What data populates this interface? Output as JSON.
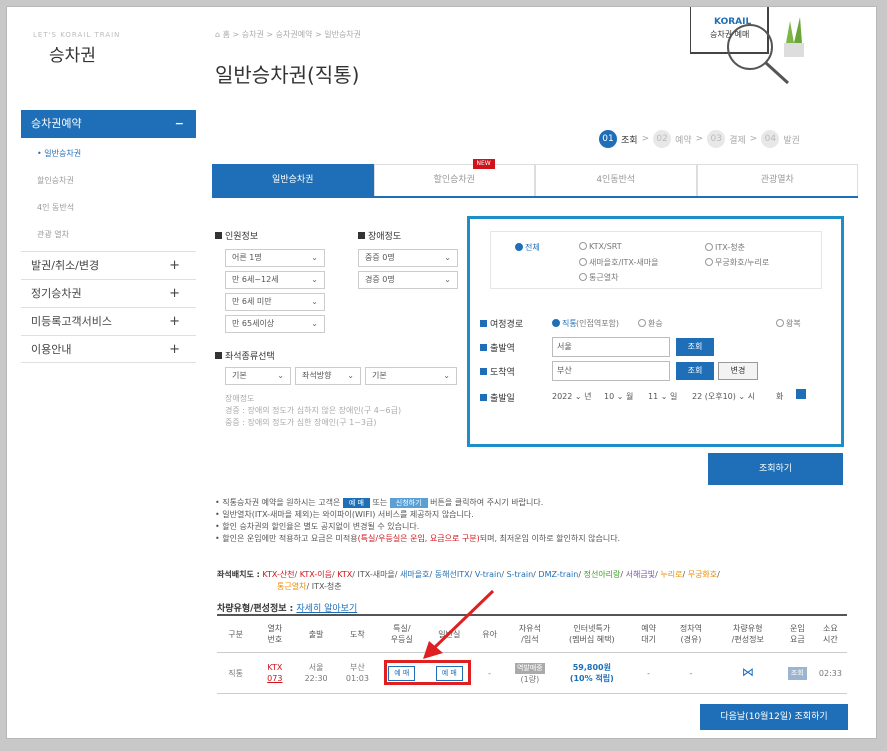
{
  "sidebar": {
    "slogan": "LET'S KORAIL TRAIN",
    "title": "승차권",
    "active_menu": "승차권예약",
    "active_toggle": "−",
    "subitems": [
      "• 일반승차권",
      "할인승차권",
      "4인 동반석",
      "관광 열차"
    ],
    "menus": [
      "발권/취소/변경",
      "정기승차권",
      "미등록고객서비스",
      "이용안내"
    ],
    "menu_toggle": "+"
  },
  "header": {
    "breadcrumb": "⌂ 홈 > 승차권 > 승차권예약 > 일반승차권",
    "title": "일반승차권(직통)",
    "logo_text": "KORAIL",
    "logo_sub": "승차권 예매"
  },
  "steps": [
    {
      "num": "01",
      "label": "조회",
      "active": true
    },
    {
      "num": "02",
      "label": "예약",
      "active": false
    },
    {
      "num": "03",
      "label": "결제",
      "active": false
    },
    {
      "num": "04",
      "label": "발권",
      "active": false
    }
  ],
  "step_sep": ">",
  "tabs": [
    "일반승차권",
    "할인승차권",
    "4인동반석",
    "관광열차"
  ],
  "new_badge": "NEW",
  "passengers": {
    "label": "인원정보",
    "adult": "어른 1명",
    "child": "만 6세~12세",
    "infant": "만 6세 미만",
    "senior": "만 65세이상",
    "disability_label": "장애정도",
    "severe": "중증 0명",
    "mild": "경증 0명",
    "arrow": "⌄"
  },
  "seat_select": {
    "label": "좌석종류선택",
    "basic": "기본",
    "direction": "좌석방향",
    "basic2": "기본",
    "note_title": "장애정도",
    "note1": "경증 : 장애의 정도가 심하지 않은 장애인(구 4~6급)",
    "note2": "중증 : 장애의 정도가 심한 장애인(구 1~3급)"
  },
  "train_types": [
    {
      "label": "전체",
      "checked": true
    },
    {
      "label": "KTX/SRT",
      "checked": false
    },
    {
      "label": "ITX-청춘",
      "checked": false
    },
    {
      "label": "새마을호/ITX-새마을",
      "checked": false
    },
    {
      "label": "무궁화호/누리로",
      "checked": false
    },
    {
      "label": "통근열차",
      "checked": false
    }
  ],
  "route": {
    "label": "여정경로",
    "direct": "직통",
    "direct_sub": "(인접역포함)",
    "transfer": "환승",
    "round": "왕복"
  },
  "origin": {
    "label": "출발역",
    "value": "서울",
    "btn": "조회"
  },
  "dest": {
    "label": "도착역",
    "value": "부산",
    "btn": "조회",
    "swap": "변경"
  },
  "date": {
    "label": "출발일",
    "year": "2022 ⌄ 년",
    "month": "10 ⌄ 월",
    "day": "11 ⌄ 일",
    "time": "22 (오후10) ⌄ 시",
    "weekday": "화"
  },
  "search_btn": "조회하기",
  "notices": {
    "n1_a": "• 직통승차권 예약을 원하시는 고객은",
    "n1_tag1": "예 매",
    "n1_mid": "또는",
    "n1_tag2": "신청하기",
    "n1_b": "버튼을 클릭하여 주시기 바랍니다.",
    "n2": "• 일반열차(ITX-새마을 제외)는 와이파이(WIFI) 서비스를 제공하지 않습니다.",
    "n3": "• 할인 승차권의 할인율은 별도 공지없이 변경될 수 있습니다.",
    "n4_a": "• 할인은 운임에만 적용하고 요금은 미적용",
    "n4_red": "(특실/우등실은 운임, 요금으로 구분)",
    "n4_b": "되며, 최저운임 이하로 할인하지 않습니다."
  },
  "seat_map": {
    "head": "좌석배치도 :",
    "items": [
      "KTX-산천",
      "KTX-이음",
      "KTX",
      "ITX-새마을",
      "새마을호",
      "동해선ITX",
      "V-train",
      "S-train",
      "DMZ-train",
      "정선아리랑",
      "서해금빛",
      "누리로",
      "무궁화호",
      "통근열차",
      "ITX-청춘"
    ],
    "sep": "/"
  },
  "vehicle": {
    "title": "차량유형/편성정보 :",
    "link": "자세히 알아보기"
  },
  "table": {
    "headers": [
      "구분",
      "열차\n번호",
      "출발\n",
      "도착\n",
      "특실/\n우등실",
      "일반실",
      "유아",
      "자유석\n/입석",
      "인터넷특가\n(멤버십 혜택)",
      "예약\n대기",
      "정차역\n(경유)",
      "차량유형\n/편성정보",
      "운임\n요금",
      "소요\n시간"
    ],
    "row": {
      "type": "직통",
      "train_kind": "KTX",
      "train_no": "073",
      "dep_station": "서울",
      "dep_time": "22:30",
      "arr_station": "부산",
      "arr_time": "01:03",
      "first_btn": "예 매",
      "normal_btn": "예 매",
      "infant": "-",
      "standing_tag": "역발매중",
      "standing_count": "(1량)",
      "special_price": "59,800원",
      "special_rate": "(10% 적립)",
      "waiting": "-",
      "stops": "-",
      "fare_btn": "조회",
      "duration": "02:33"
    }
  },
  "next_day_btn": "다음날(10월12일) 조회하기",
  "colors": {
    "primary": "#1e6fb7",
    "highlight": "#e02020",
    "accent_red": "#d0121b"
  }
}
